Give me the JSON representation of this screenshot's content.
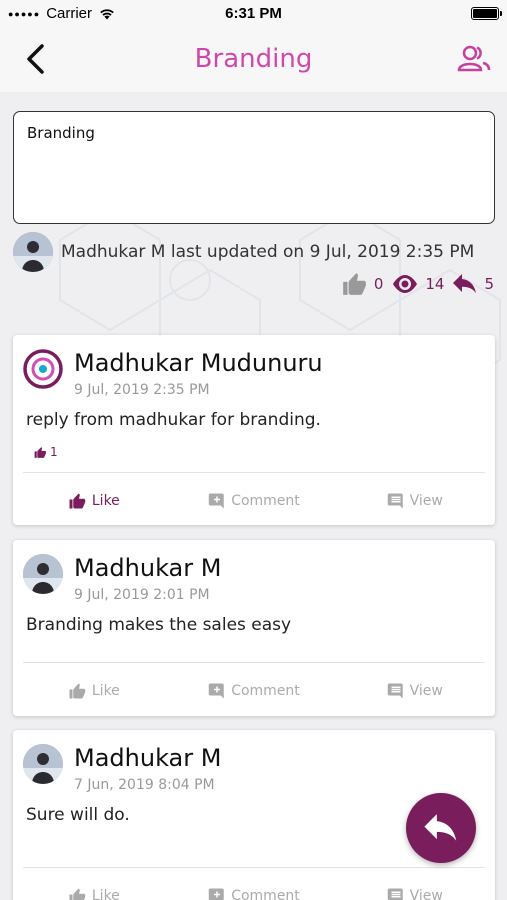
{
  "status_bar": {
    "carrier": "Carrier",
    "time": "6:31 PM"
  },
  "header": {
    "title": "Branding",
    "back_icon": "chevron-left-icon",
    "members_icon": "users-icon"
  },
  "topic": {
    "description": "Branding",
    "updated_by": "Madhukar M last updated on 9 Jul, 2019 2:35 PM",
    "likes": "0",
    "views": "14",
    "replies": "5"
  },
  "posts": [
    {
      "author": "Madhukar Mudunuru",
      "date": "9 Jul, 2019 2:35 PM",
      "text": "reply from madhukar for branding.",
      "likes": "1",
      "liked": true
    },
    {
      "author": "Madhukar M",
      "date": "9 Jul, 2019 2:01 PM",
      "text": "Branding makes the sales easy",
      "liked": false
    },
    {
      "author": "Madhukar M",
      "date": "7 Jun, 2019 8:04 PM",
      "text": "Sure will do.",
      "liked": false
    }
  ],
  "actions": {
    "like": "Like",
    "comment": "Comment",
    "view": "View"
  },
  "colors": {
    "accent": "#7a1d5c",
    "title": "#c046b0",
    "muted": "#aaaaaa"
  }
}
